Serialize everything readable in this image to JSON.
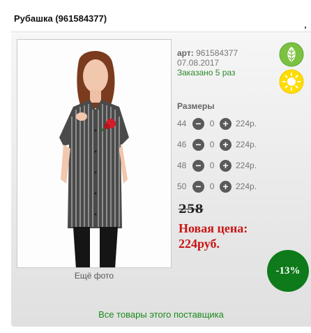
{
  "product": {
    "title": "Рубашка (961584377)",
    "art_label": "арт:",
    "art_value": "961584377",
    "date": "07.08.2017",
    "ordered": "Заказано 5 раз",
    "more_photo": "Ещё фото"
  },
  "sizes": {
    "title": "Размеры",
    "rows": [
      {
        "size": "44",
        "qty": "0",
        "price": "224р."
      },
      {
        "size": "46",
        "qty": "0",
        "price": "224р."
      },
      {
        "size": "48",
        "qty": "0",
        "price": "224р."
      },
      {
        "size": "50",
        "qty": "0",
        "price": "224р."
      }
    ],
    "minus": "−",
    "plus": "+"
  },
  "pricing": {
    "old_price": "258",
    "new_price_label": "Новая цена:",
    "new_price_value": "224руб.",
    "discount": "-13%"
  },
  "footer": {
    "supplier_link": "Все товары этого поставщика"
  },
  "icons": {
    "eco": "leaf-icon",
    "sun": "sun-icon"
  },
  "colors": {
    "accent_green": "#1c8a1c",
    "price_red": "#c81414",
    "discount_bg": "#0e7a1a"
  }
}
